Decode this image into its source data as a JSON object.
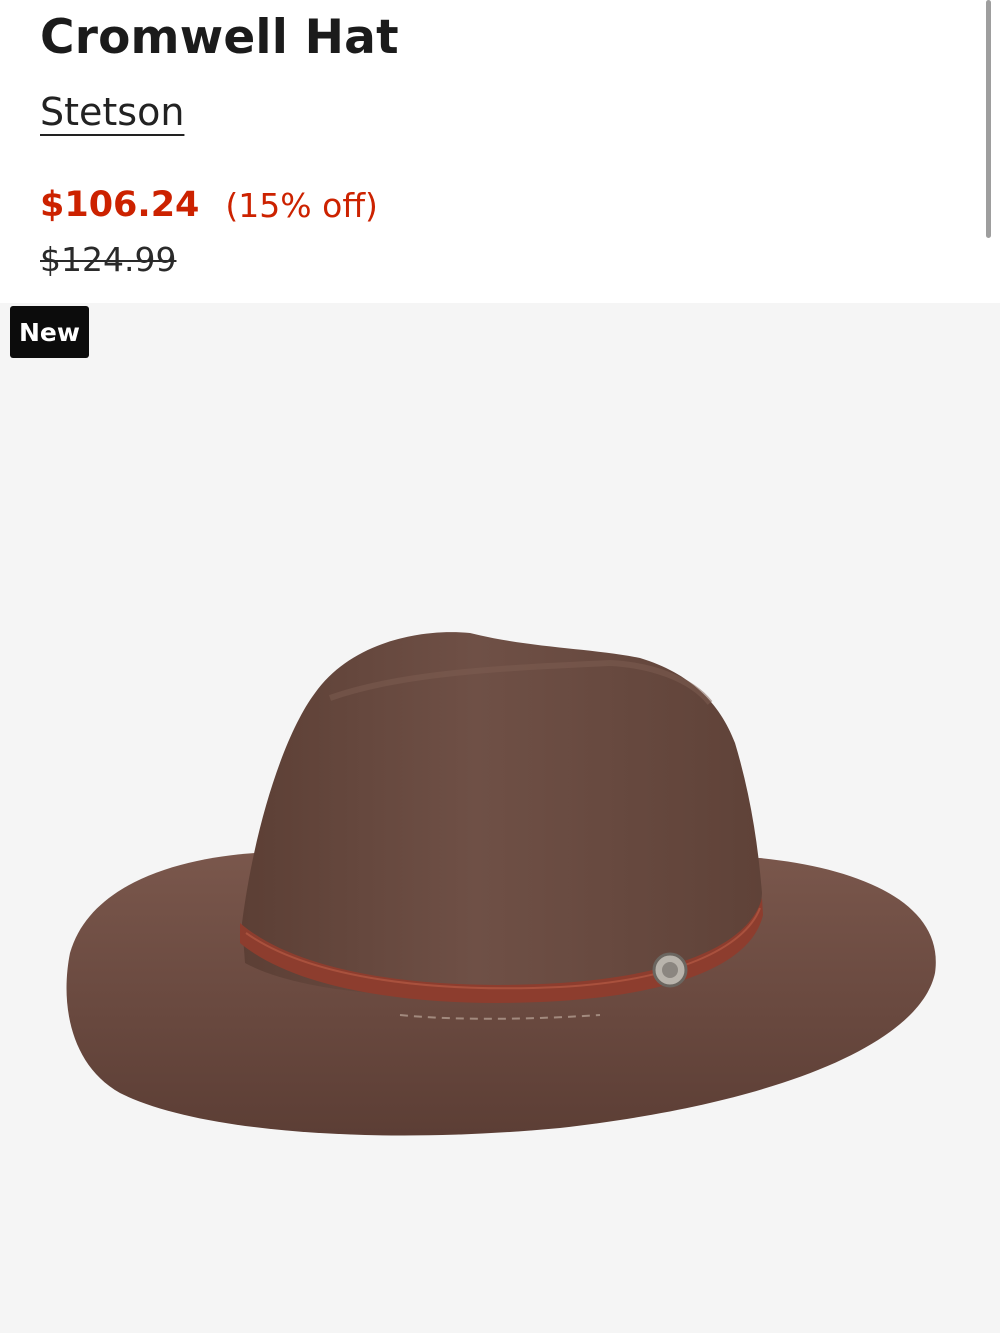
{
  "product": {
    "title": "Cromwell Hat",
    "brand": "Stetson",
    "sale_price": "$106.24",
    "discount": "(15% off)",
    "original_price": "$124.99",
    "badge": "New",
    "image_icon": "brown-felt-hat-image"
  },
  "colors": {
    "sale": "#cc2200",
    "badge_bg": "#0c0c0c",
    "image_bg": "#f5f5f5",
    "hat_felt": "#6a4b41",
    "hat_band": "#8d3d2e"
  }
}
